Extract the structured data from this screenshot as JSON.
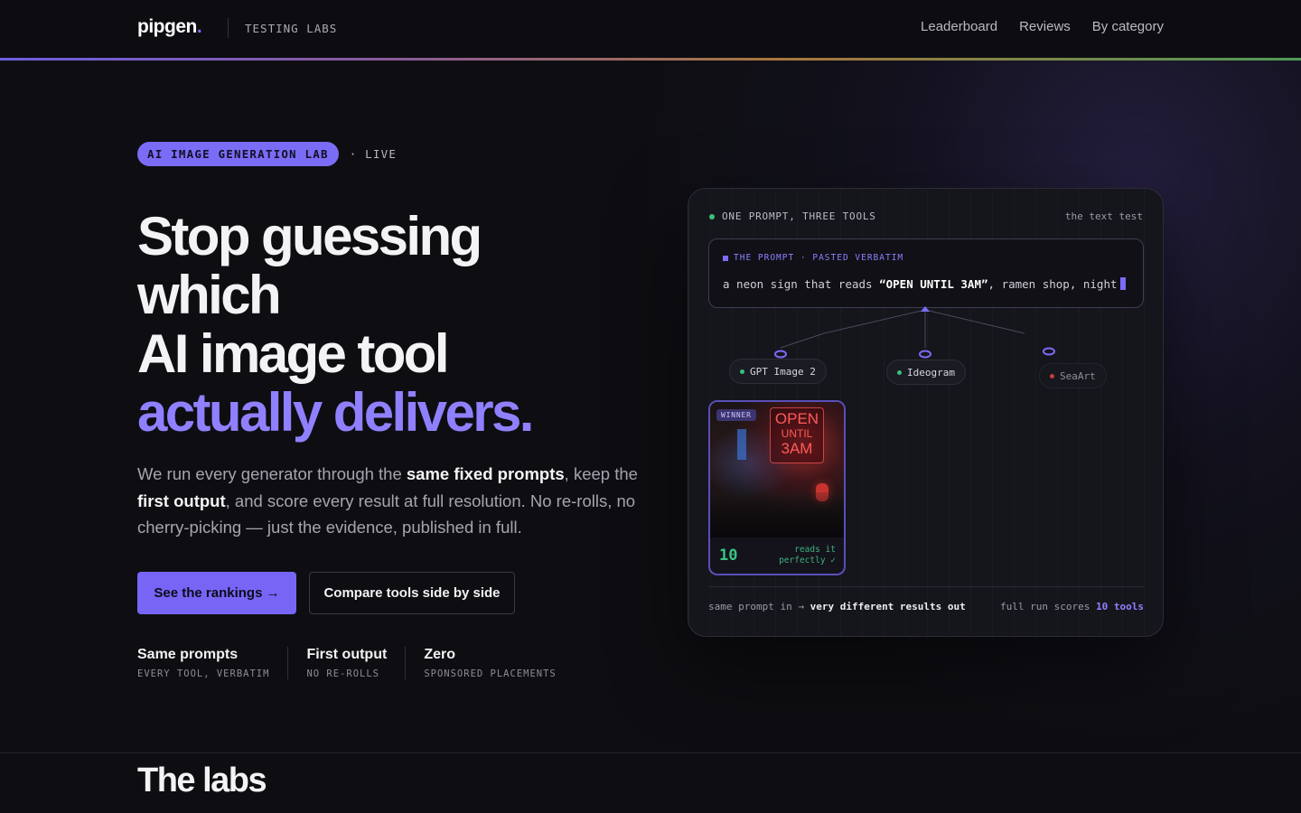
{
  "header": {
    "logo": "pipgen",
    "logo_dot": ".",
    "tag": "TESTING LABS",
    "nav": [
      "Leaderboard",
      "Reviews",
      "By category"
    ]
  },
  "hero": {
    "badge": "AI IMAGE GENERATION LAB",
    "status": "· LIVE",
    "headline": {
      "line1": "Stop guessing",
      "line2": "which",
      "line3": "AI image tool",
      "line4_accent": "actually delivers."
    },
    "lede": {
      "p1": "We run every generator through the ",
      "b1": "same fixed prompts",
      "p2": ", keep the ",
      "b2": "first output",
      "p3": ", and score every result at full resolution. No re-rolls, no cherry-picking — just the evidence, published in full."
    },
    "cta_primary": "See the rankings →",
    "cta_secondary": "Compare tools side by side",
    "stats": [
      {
        "title": "Same prompts",
        "sub": "EVERY TOOL, VERBATIM"
      },
      {
        "title": "First output",
        "sub": "NO RE-ROLLS"
      },
      {
        "title": "Zero",
        "sub": "SPONSORED PLACEMENTS"
      }
    ]
  },
  "demo": {
    "heading": "ONE PROMPT, THREE TOOLS",
    "heading_right": "the text test",
    "prompt_label": "THE PROMPT · PASTED VERBATIM",
    "prompt_pre": "a neon sign that reads ",
    "prompt_bold": "“OPEN UNTIL 3AM”",
    "prompt_post": ", ramen shop, night",
    "tools": [
      {
        "name": "GPT Image 2",
        "dot_color": "#3ac07a"
      },
      {
        "name": "Ideogram",
        "dot_color": "#3ac07a"
      },
      {
        "name": "SeaArt",
        "dot_color": "#c0413a"
      }
    ],
    "winner": {
      "tag": "WINNER",
      "sign": [
        "OPEN",
        "UNTIL",
        "3AM"
      ],
      "score": "10",
      "verdict": "reads it perfectly ✓"
    },
    "footer_left_pre": "same prompt in → ",
    "footer_left_bold": "very different results out",
    "footer_right_pre": "full run scores ",
    "footer_right_accent": "10 tools"
  },
  "labs": {
    "title": "The labs"
  },
  "colors": {
    "accent": "#7765f5",
    "accent_text": "#8f80ff",
    "background": "#0e0e12",
    "success": "#38c580"
  }
}
